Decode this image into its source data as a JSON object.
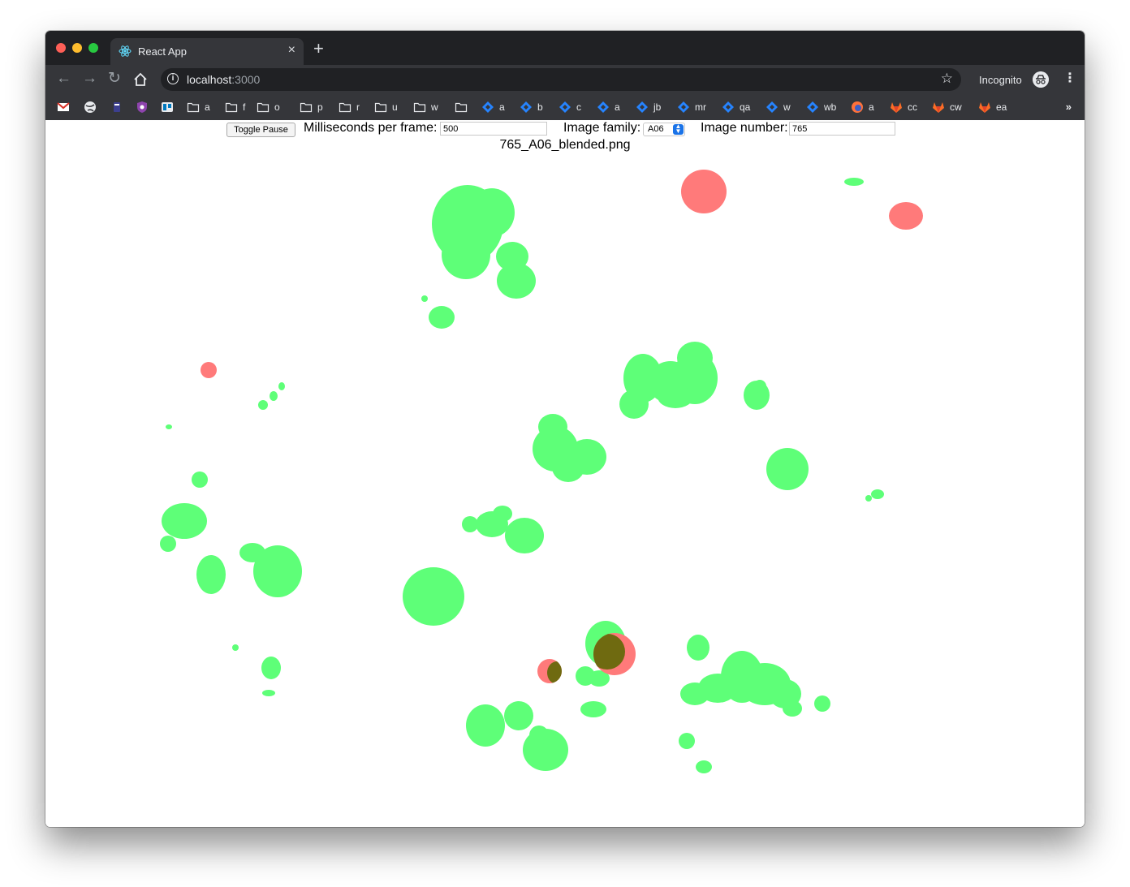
{
  "browser": {
    "tab": {
      "title": "React App"
    },
    "url": {
      "host": "localhost",
      "port": ":3000"
    },
    "incognito_label": "Incognito",
    "bookmarks": [
      {
        "icon": "gmail-icon",
        "label": ""
      },
      {
        "icon": "globe-icon",
        "label": ""
      },
      {
        "icon": "app-icon",
        "label": ""
      },
      {
        "icon": "shield-icon",
        "label": ""
      },
      {
        "icon": "trello-icon",
        "label": ""
      },
      {
        "icon": "folder-icon",
        "label": "a"
      },
      {
        "icon": "folder-icon",
        "label": "f"
      },
      {
        "icon": "folder-icon",
        "label": "o"
      },
      {
        "icon": "folder-icon",
        "label": "p"
      },
      {
        "icon": "folder-icon",
        "label": "r"
      },
      {
        "icon": "folder-icon",
        "label": "u"
      },
      {
        "icon": "folder-icon",
        "label": "w"
      },
      {
        "icon": "folder-icon",
        "label": ""
      },
      {
        "icon": "jira-icon",
        "label": "a"
      },
      {
        "icon": "jira-icon",
        "label": "b"
      },
      {
        "icon": "jira-icon",
        "label": "c"
      },
      {
        "icon": "jira-icon",
        "label": "a"
      },
      {
        "icon": "jira-icon",
        "label": "jb"
      },
      {
        "icon": "jira-icon",
        "label": "mr"
      },
      {
        "icon": "jira-icon",
        "label": "qa"
      },
      {
        "icon": "jira-icon",
        "label": "w"
      },
      {
        "icon": "jira-icon",
        "label": "wb"
      },
      {
        "icon": "firefox-icon",
        "label": "a"
      },
      {
        "icon": "gitlab-icon",
        "label": "cc"
      },
      {
        "icon": "gitlab-icon",
        "label": "cw"
      },
      {
        "icon": "gitlab-icon",
        "label": "ea"
      }
    ],
    "more_label": "»"
  },
  "controls": {
    "toggle_label": "Toggle Pause",
    "ms_label": "Milliseconds per frame:",
    "ms_value": "500",
    "family_label": "Image family:",
    "family_value": "A06",
    "number_label": "Image number:",
    "number_value": "765"
  },
  "image": {
    "filename": "765_A06_blended.png",
    "colors": {
      "green": "#5eff78",
      "red": "#ff7a7a",
      "overlap": "#6f6a10"
    }
  }
}
